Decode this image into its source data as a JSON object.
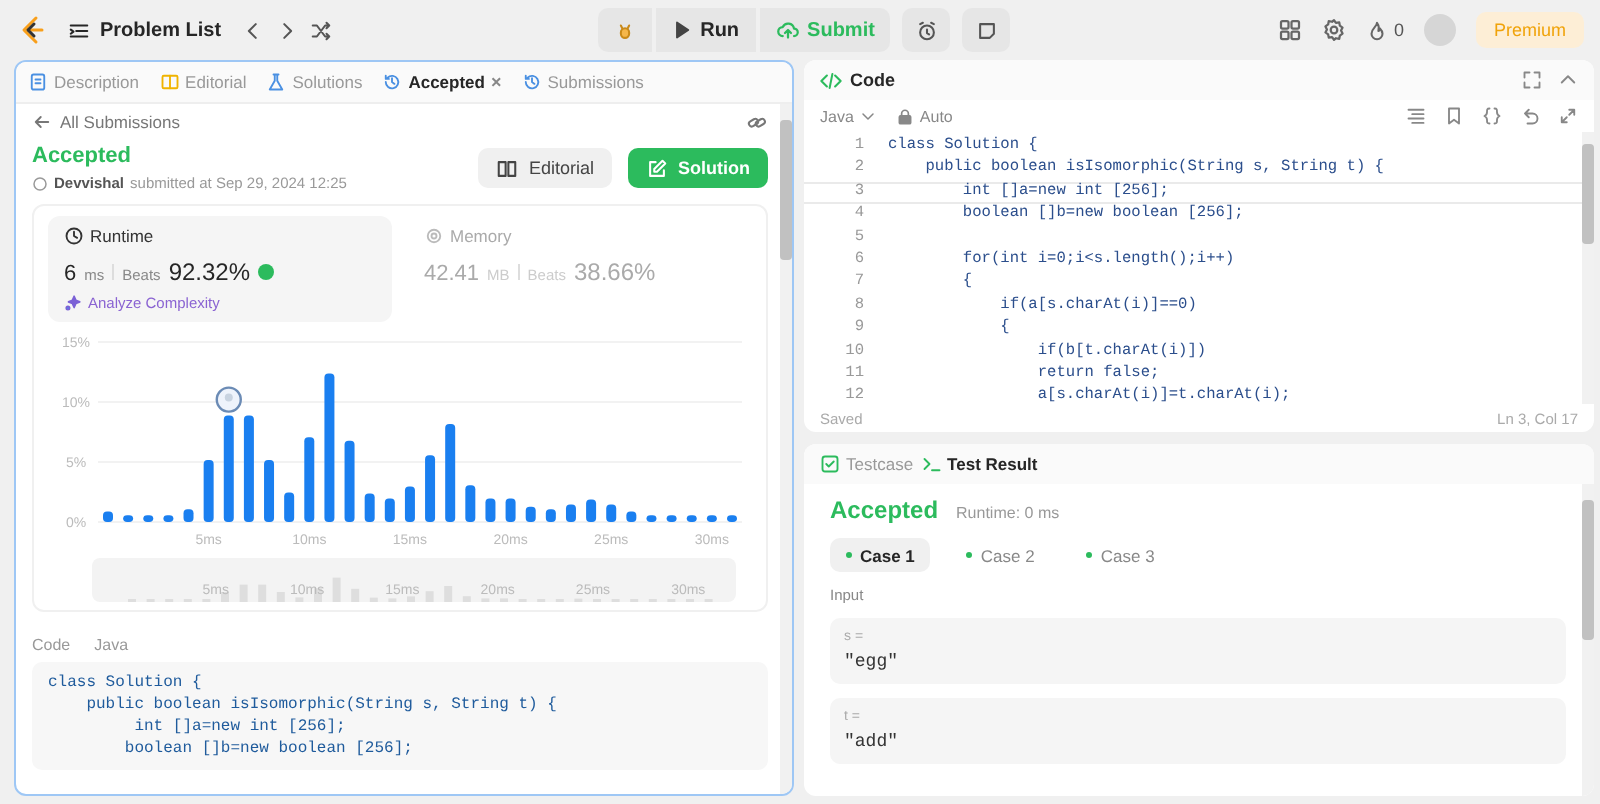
{
  "topbar": {
    "problem_list": "Problem List",
    "run": "Run",
    "submit": "Submit",
    "streak": "0",
    "premium": "Premium"
  },
  "left_tabs": [
    {
      "label": "Description",
      "kind": "description",
      "selected": false
    },
    {
      "label": "Editorial",
      "kind": "editorial",
      "selected": false
    },
    {
      "label": "Solutions",
      "kind": "solutions",
      "selected": false
    },
    {
      "label": "Accepted",
      "kind": "history",
      "selected": true,
      "close": "×"
    },
    {
      "label": "Submissions",
      "kind": "history",
      "selected": false
    }
  ],
  "back_link": "All Submissions",
  "submission": {
    "status": "Accepted",
    "user": "Devvishal",
    "submitted": "submitted at Sep 29, 2024 12:25",
    "editorial_button": "Editorial",
    "solution_button": "Solution"
  },
  "metrics": [
    {
      "kind": "runtime",
      "title": "Runtime",
      "value": "6",
      "unit": "ms",
      "beats_label": "Beats",
      "beats": "92.32%",
      "selected": true,
      "analyze": "Analyze Complexity"
    },
    {
      "kind": "memory",
      "title": "Memory",
      "value": "42.41",
      "unit": "MB",
      "beats_label": "Beats",
      "beats": "38.66%",
      "selected": false
    }
  ],
  "chart_data": {
    "type": "bar",
    "x": [
      0,
      1,
      2,
      3,
      4,
      5,
      6,
      7,
      8,
      9,
      10,
      11,
      12,
      13,
      14,
      15,
      16,
      17,
      18,
      19,
      20,
      21,
      22,
      23,
      24,
      25,
      26,
      27,
      28,
      29,
      30,
      31
    ],
    "xlim": [
      0,
      31
    ],
    "series": [
      {
        "color": "#1a7ff0",
        "values": [
          0.7,
          0.4,
          0.4,
          0.4,
          0.9,
          5.0,
          8.7,
          8.7,
          5.0,
          2.3,
          6.9,
          12.2,
          6.6,
          2.2,
          1.8,
          2.8,
          5.4,
          8.0,
          2.9,
          1.8,
          1.8,
          1.1,
          0.9,
          1.3,
          1.7,
          1.3,
          0.7,
          0.4,
          0.4,
          0.4,
          0.4,
          0.4
        ]
      }
    ],
    "ylim": [
      0,
      15
    ],
    "yticks": [
      {
        "value": 0,
        "label": "0%"
      },
      {
        "value": 5,
        "label": "5%"
      },
      {
        "value": 10,
        "label": "10%"
      },
      {
        "value": 15,
        "label": "15%"
      }
    ],
    "xticks": [
      {
        "value": 5,
        "label": "5ms"
      },
      {
        "value": 10,
        "label": "10ms"
      },
      {
        "value": 15,
        "label": "15ms"
      },
      {
        "value": 20,
        "label": "20ms"
      },
      {
        "value": 25,
        "label": "25ms"
      },
      {
        "value": 30,
        "label": "30ms"
      }
    ]
  },
  "navigator_labels": [
    "5ms",
    "10ms",
    "15ms",
    "20ms",
    "25ms",
    "30ms"
  ],
  "submitted_code": {
    "label": "Code",
    "language": "Java",
    "lines": [
      "class Solution {",
      "    public boolean isIsomorphic(String s, String t) {",
      "         int []a=new int [256];",
      "        boolean []b=new boolean [256];"
    ]
  },
  "editor": {
    "title": "Code",
    "language": "Java",
    "mode": "Auto",
    "status": "Saved",
    "position": "Ln 3, Col 17",
    "lines": [
      {
        "number": "1",
        "code": "class Solution {",
        "current": false
      },
      {
        "number": "2",
        "code": "    public boolean isIsomorphic(String s, String t) {",
        "current": false
      },
      {
        "number": "3",
        "code": "        int []a=new int [256];",
        "current": true
      },
      {
        "number": "4",
        "code": "        boolean []b=new boolean [256];",
        "current": false
      },
      {
        "number": "5",
        "current": false
      },
      {
        "number": "6",
        "code": "        for(int i=0;i<s.length();i++)",
        "current": false
      },
      {
        "number": "7",
        "code": "        {",
        "current": false
      },
      {
        "number": "8",
        "code": "            if(a[s.charAt(i)]==0)",
        "current": false
      },
      {
        "number": "9",
        "code": "            {",
        "current": false
      },
      {
        "number": "10",
        "code": "                if(b[t.charAt(i)])",
        "current": false
      },
      {
        "number": "11",
        "code": "                return false;",
        "current": false
      },
      {
        "number": "12",
        "code": "                a[s.charAt(i)]=t.charAt(i);",
        "current": false
      }
    ]
  },
  "bottom_tabs": [
    {
      "label": "Testcase",
      "kind": "testcase",
      "selected": false
    },
    {
      "label": "Test Result",
      "kind": "result",
      "selected": true
    }
  ],
  "result": {
    "status": "Accepted",
    "runtime": "Runtime: 0 ms"
  },
  "cases": [
    {
      "label": "Case 1",
      "selected": true
    },
    {
      "label": "Case 2",
      "selected": false
    },
    {
      "label": "Case 3",
      "selected": false
    }
  ],
  "input_label": "Input",
  "inputs": [
    {
      "name": "s =",
      "value": "\"egg\""
    },
    {
      "name": "t =",
      "value": "\"add\""
    }
  ]
}
